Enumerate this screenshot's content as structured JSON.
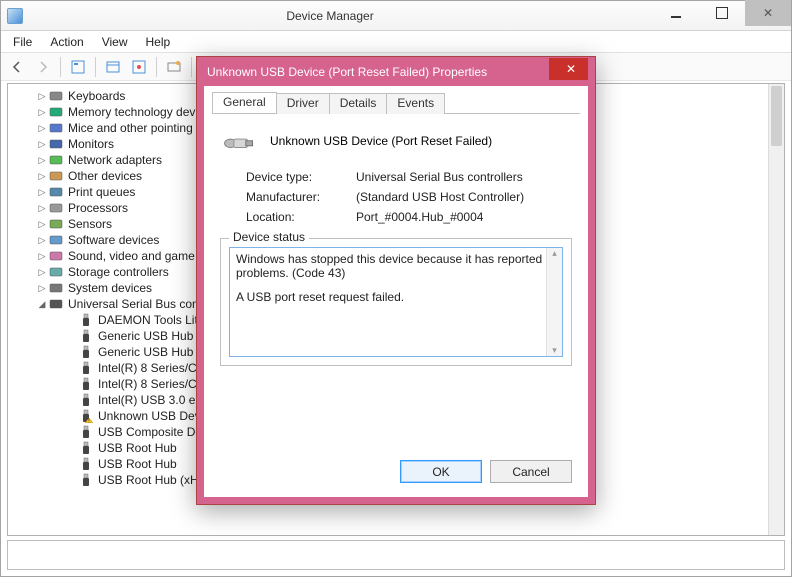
{
  "window": {
    "title": "Device Manager",
    "menus": [
      "File",
      "Action",
      "View",
      "Help"
    ]
  },
  "toolbar": {
    "back": "nav-back",
    "forward": "nav-forward",
    "properties": "show-properties",
    "scan": "scan-hardware",
    "help": "toolbar-help"
  },
  "tree": {
    "categories": [
      {
        "label": "Keyboards"
      },
      {
        "label": "Memory technology devices"
      },
      {
        "label": "Mice and other pointing devices"
      },
      {
        "label": "Monitors"
      },
      {
        "label": "Network adapters"
      },
      {
        "label": "Other devices"
      },
      {
        "label": "Print queues"
      },
      {
        "label": "Processors"
      },
      {
        "label": "Sensors"
      },
      {
        "label": "Software devices"
      },
      {
        "label": "Sound, video and game controllers"
      },
      {
        "label": "Storage controllers"
      },
      {
        "label": "System devices"
      },
      {
        "label": "Universal Serial Bus controllers",
        "expanded": true
      }
    ],
    "usb_children": [
      "DAEMON Tools Lite Virtual Bus",
      "Generic USB Hub",
      "Generic USB Hub",
      "Intel(R) 8 Series/C220 Series USB EHCI",
      "Intel(R) 8 Series/C220 Series USB EHCI",
      "Intel(R) USB 3.0 eXtensible Host Controller",
      "Unknown USB Device (Port Reset Failed)",
      "USB Composite Device",
      "USB Root Hub",
      "USB Root Hub",
      "USB Root Hub (xHCI)"
    ]
  },
  "dialog": {
    "title": "Unknown USB Device (Port Reset Failed) Properties",
    "tabs": [
      "General",
      "Driver",
      "Details",
      "Events"
    ],
    "active_tab": "General",
    "device_name": "Unknown USB Device (Port Reset Failed)",
    "rows": {
      "device_type_label": "Device type:",
      "device_type_value": "Universal Serial Bus controllers",
      "manufacturer_label": "Manufacturer:",
      "manufacturer_value": "(Standard USB Host Controller)",
      "location_label": "Location:",
      "location_value": "Port_#0004.Hub_#0004"
    },
    "status_legend": "Device status",
    "status_line1": "Windows has stopped this device because it has reported problems. (Code 43)",
    "status_line2": "A USB port reset request failed.",
    "ok": "OK",
    "cancel": "Cancel",
    "close_glyph": "✕"
  }
}
